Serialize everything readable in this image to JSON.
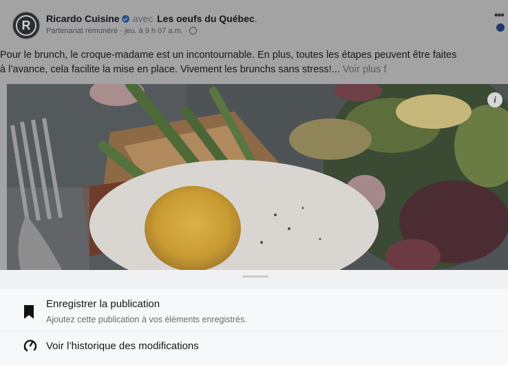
{
  "post": {
    "author": "Ricardo Cuisine",
    "with_word": "avec",
    "partner": "Les oeufs du Québec",
    "partner_punct": ".",
    "meta": "Partenariat rémunéré · jeu. à 9 h 07 a.m. ·",
    "avatar_letter": "R",
    "more_label": "•••",
    "caption_line1": "Pour le brunch, le croque-madame est un incontournable. En plus, toutes les étapes peuvent être faites",
    "caption_line2": "à l’avance, cela facilite la mise en place. Vivement les brunchs sans stress!...",
    "see_more": "Voir plus f",
    "info_label": "i"
  },
  "sheet": {
    "items": [
      {
        "title": "Enregistrer la publication",
        "subtitle": "Ajoutez cette publication à vos éléments enregistrés.",
        "icon": "bookmark-icon"
      },
      {
        "title": "Voir l’historique des modifications",
        "icon": "history-icon"
      }
    ]
  },
  "colors": {
    "dim_overlay": "#a3a3a4",
    "sheet_bg": "#f0f1f3",
    "verified": "#2a4f86"
  }
}
